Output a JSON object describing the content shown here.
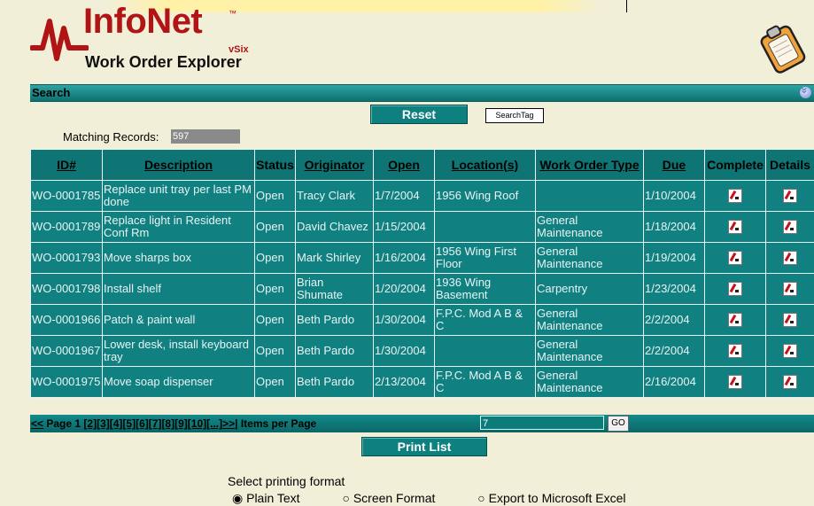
{
  "header": {
    "logo_title": "InfoNet",
    "logo_tm": "™",
    "logo_version": "vSix",
    "logo_subtitle": "Work Order Explorer"
  },
  "search": {
    "label": "Search",
    "reset_label": "Reset",
    "searchtag_label": "SearchTag",
    "matching_label": "Matching Records:",
    "matching_count": "597"
  },
  "table": {
    "columns": [
      "ID#",
      "Description",
      "Status",
      "Originator",
      "Open",
      "Location(s)",
      "Work Order Type",
      "Due",
      "Complete",
      "Details"
    ],
    "rows": [
      {
        "id": "WO-0001785",
        "description": "Replace unit tray per last PM done",
        "status": "Open",
        "originator": "Tracy Clark",
        "open": "1/7/2004",
        "location": "1956 Wing Roof",
        "type": "",
        "due": "1/10/2004"
      },
      {
        "id": "WO-0001789",
        "description": "Replace light in Resident Conf Rm",
        "status": "Open",
        "originator": "David Chavez",
        "open": "1/15/2004",
        "location": "",
        "type": "General Maintenance",
        "due": "1/18/2004"
      },
      {
        "id": "WO-0001793",
        "description": "Move sharps box",
        "status": "Open",
        "originator": "Mark Shirley",
        "open": "1/16/2004",
        "location": "1956 Wing First Floor",
        "type": "General Maintenance",
        "due": "1/19/2004"
      },
      {
        "id": "WO-0001798",
        "description": "Install shelf",
        "status": "Open",
        "originator": "Brian Shumate",
        "open": "1/20/2004",
        "location": "1936 Wing Basement",
        "type": "Carpentry",
        "due": "1/23/2004"
      },
      {
        "id": "WO-0001966",
        "description": "Patch & paint wall",
        "status": "Open",
        "originator": "Beth Pardo",
        "open": "1/30/2004",
        "location": "F.P.C. Mod A B & C",
        "type": "General Maintenance",
        "due": "2/2/2004"
      },
      {
        "id": "WO-0001967",
        "description": "Lower desk, install keyboard tray",
        "status": "Open",
        "originator": "Beth Pardo",
        "open": "1/30/2004",
        "location": "",
        "type": "General Maintenance",
        "due": "2/2/2004"
      },
      {
        "id": "WO-0001975",
        "description": "Move soap dispenser",
        "status": "Open",
        "originator": "Beth Pardo",
        "open": "2/13/2004",
        "location": "F.P.C. Mod A B & C",
        "type": "General Maintenance",
        "due": "2/16/2004"
      }
    ]
  },
  "pager": {
    "prev": "<<",
    "page_label": "Page 1",
    "pages": [
      "[2]",
      "[3]",
      "[4]",
      "[5]",
      "[6]",
      "[7]",
      "[8]",
      "[9]",
      "[10]",
      "[...]"
    ],
    "next": ">>",
    "items_label": "| Items per Page",
    "items_value": "7",
    "go_label": "GO"
  },
  "print": {
    "button_label": "Print List",
    "format_label": "Select printing format",
    "options": [
      "Plain Text",
      "Screen Format",
      "Export to Microsoft Excel"
    ],
    "selected": "Plain Text"
  },
  "colors": {
    "teal": "#118080",
    "background": "#f2efd9",
    "brand_red": "#b11414"
  }
}
